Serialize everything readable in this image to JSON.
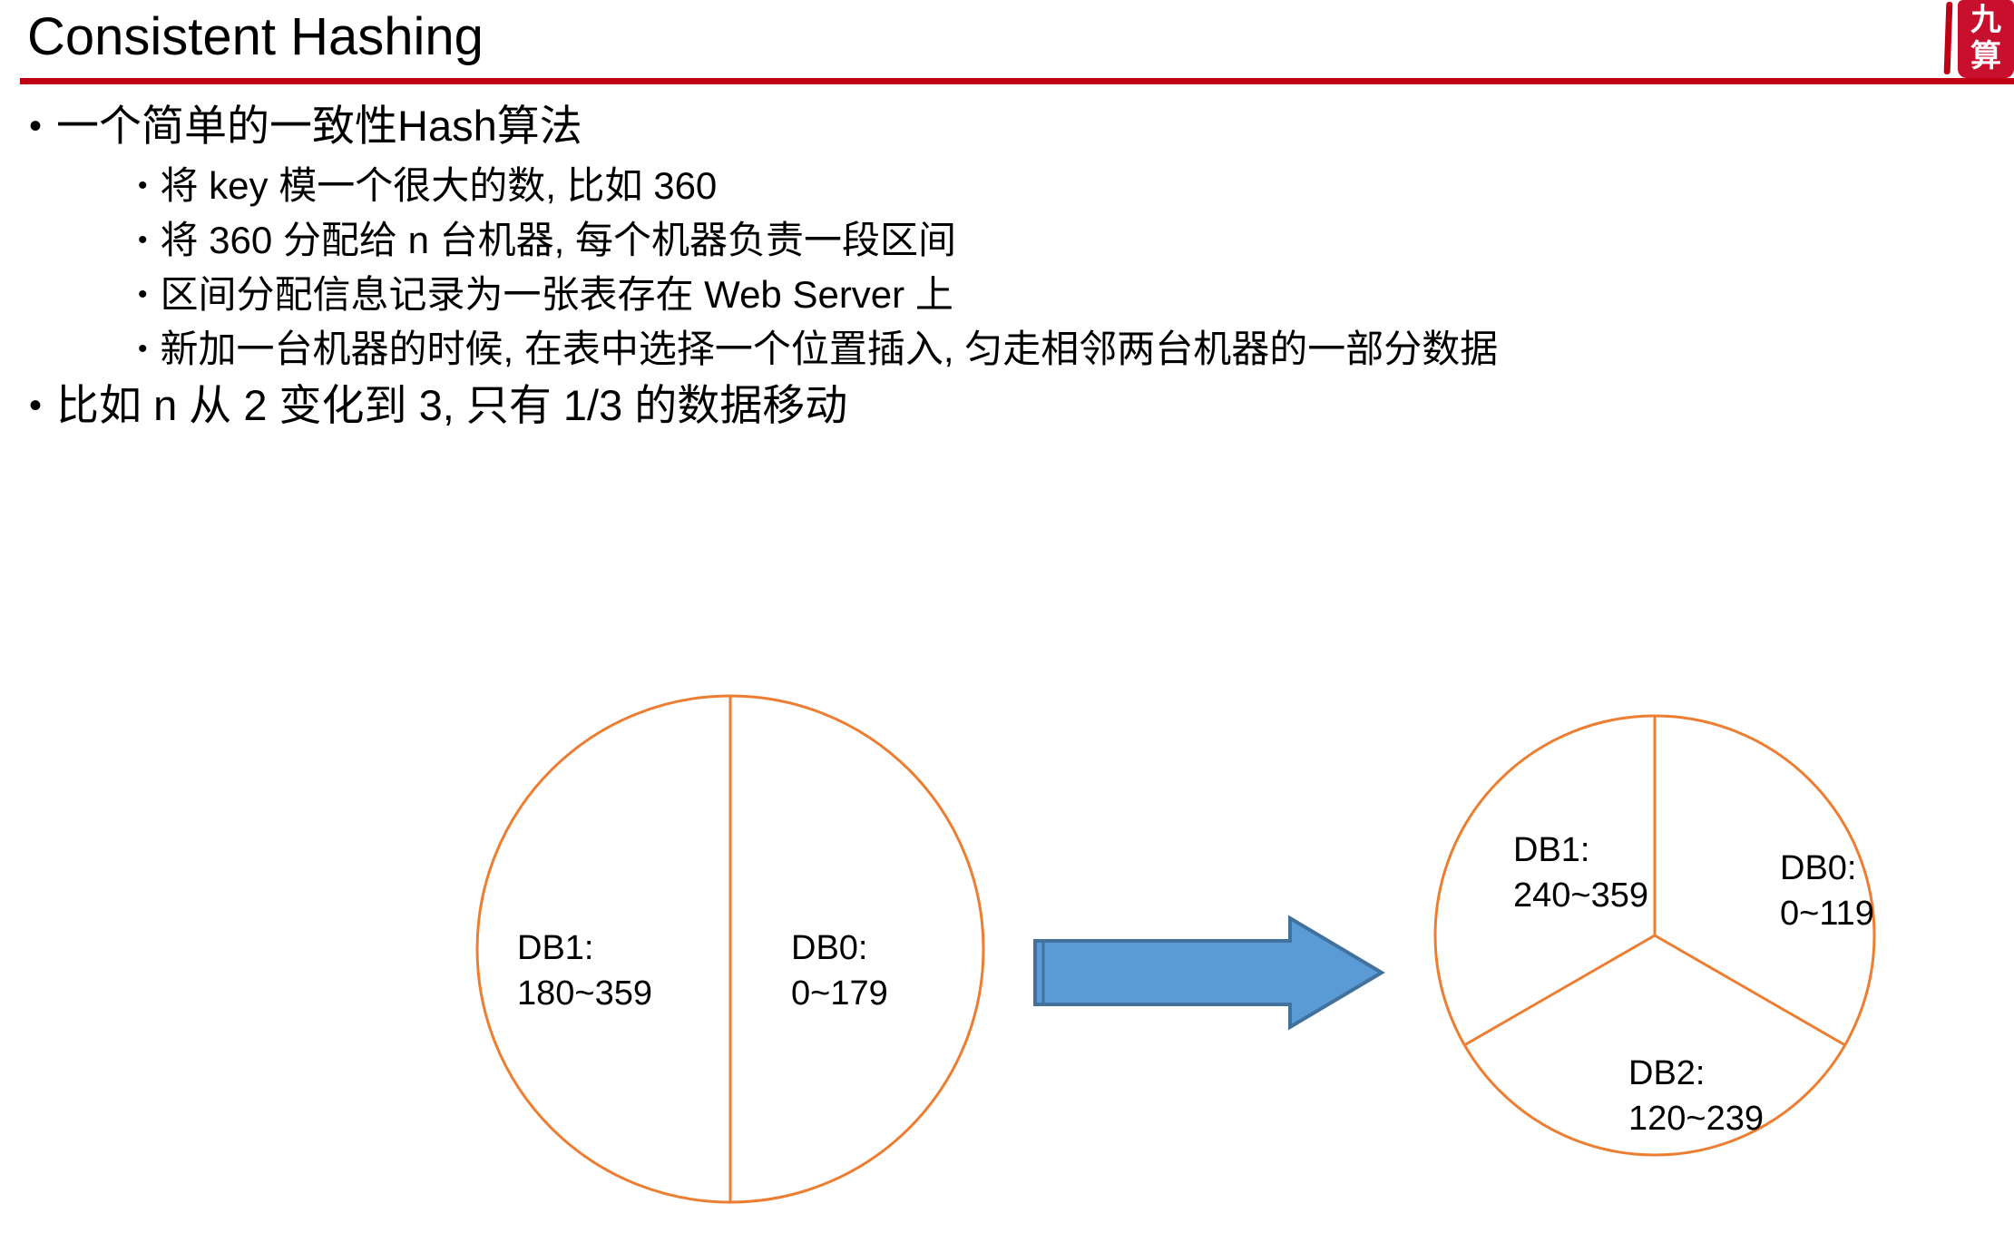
{
  "slide": {
    "title": "Consistent Hashing",
    "rule_color": "#c00014"
  },
  "logo": {
    "char_top": "九",
    "char_bottom": "算",
    "color": "#c8102e"
  },
  "bullets": [
    {
      "level": 1,
      "marker": "•",
      "text": "一个简单的一致性Hash算法"
    },
    {
      "level": 2,
      "marker": "•",
      "text": "将 key 模一个很大的数, 比如 360"
    },
    {
      "level": 2,
      "marker": "•",
      "text": "将 360 分配给 n 台机器, 每个机器负责一段区间"
    },
    {
      "level": 2,
      "marker": "•",
      "text": "区间分配信息记录为一张表存在 Web Server 上"
    },
    {
      "level": 2,
      "marker": "•",
      "text": "新加一台机器的时候, 在表中选择一个位置插入, 匀走相邻两台机器的一部分数据"
    },
    {
      "level": 1,
      "marker": "•",
      "text": "比如 n 从 2 变化到 3, 只有 1/3 的数据移动"
    }
  ],
  "chart_data": [
    {
      "type": "pie",
      "name": "before",
      "title": "",
      "stroke_color": "#ed7d31",
      "fill_color": "#ffffff",
      "categories": [
        "DB0",
        "DB1"
      ],
      "values": [
        180,
        180
      ],
      "labels": [
        {
          "name": "DB1:",
          "range": "180~359"
        },
        {
          "name": "DB0:",
          "range": "0~179"
        }
      ]
    },
    {
      "type": "pie",
      "name": "after",
      "title": "",
      "stroke_color": "#ed7d31",
      "fill_color": "#ffffff",
      "categories": [
        "DB0",
        "DB2",
        "DB1"
      ],
      "values": [
        120,
        120,
        120
      ],
      "labels": [
        {
          "name": "DB1:",
          "range": "240~359"
        },
        {
          "name": "DB0:",
          "range": "0~119"
        },
        {
          "name": "DB2:",
          "range": "120~239"
        }
      ]
    }
  ],
  "arrow": {
    "direction": "right",
    "fill_color": "#5b9bd5",
    "stroke_color": "#41719c"
  }
}
